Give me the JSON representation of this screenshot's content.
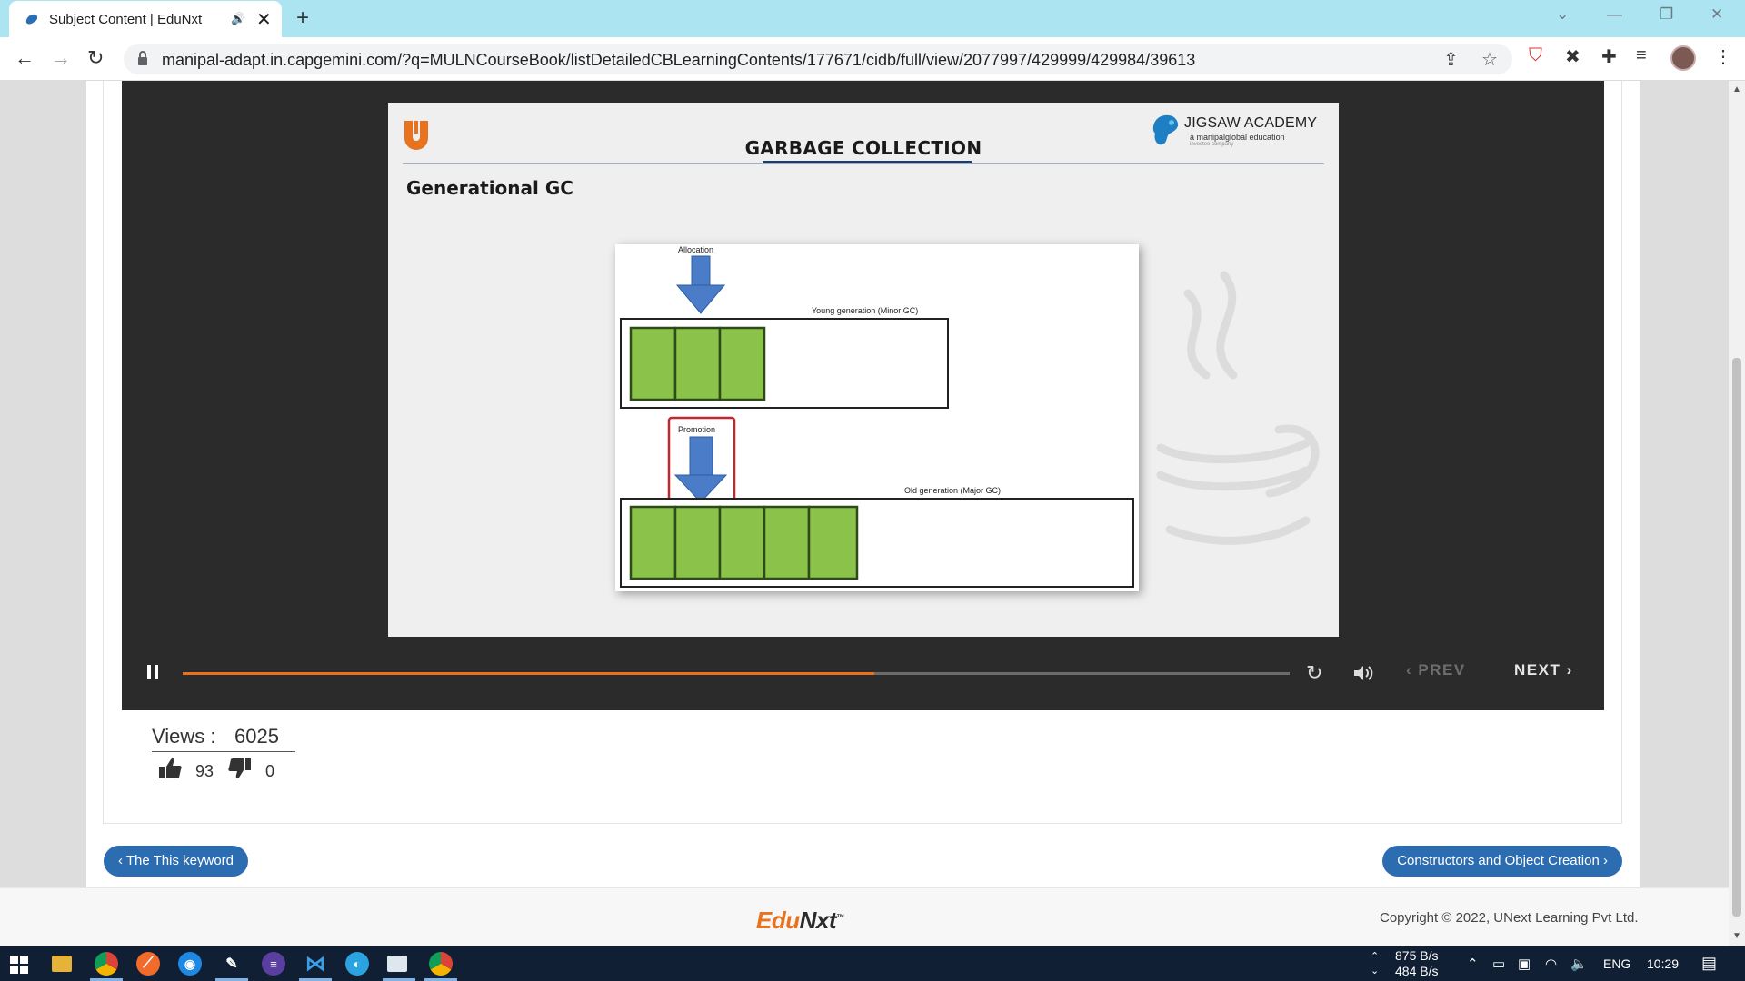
{
  "browser": {
    "tab_title": "Subject Content | EduNxt",
    "tab_audio_glyph": "🔊",
    "tab_close_glyph": "✕",
    "new_tab_glyph": "+",
    "url": "manipal-adapt.in.capgemini.com/?q=MULNCourseBook/listDetailedCBLearningContents/177671/cidb/full/view/2077997/429999/429984/39613"
  },
  "slide": {
    "title": "GARBAGE COLLECTION",
    "subtitle": "Generational GC",
    "brand_name": "JIGSAW ACADEMY",
    "brand_sub": "a manipalglobal education",
    "brand_tag": "investee company",
    "diagram": {
      "allocation_label": "Allocation",
      "young_label": "Young generation (Minor GC)",
      "promotion_label": "Promotion",
      "old_label": "Old generation (Major GC)"
    }
  },
  "player": {
    "progress_fraction": 0.625,
    "prev_label": "PREV",
    "next_label": "NEXT",
    "progress_color": "#e8721d"
  },
  "stats": {
    "views_label": "Views :",
    "views_value": "6025",
    "likes": "93",
    "dislikes": "0"
  },
  "navigation": {
    "prev_topic": "‹ The This keyword",
    "next_topic": "Constructors and Object Creation ›"
  },
  "footer": {
    "logo_part1": "Edu",
    "logo_part2": "Nxt",
    "logo_tm": "™",
    "copyright": "Copyright © 2022, UNext Learning Pvt Ltd."
  },
  "taskbar": {
    "upload_speed": "875 B/s",
    "download_speed": "484 B/s",
    "language": "ENG",
    "time": "10:29"
  },
  "colors": {
    "accent_blue": "#2c6cb0",
    "tab_strip": "#ade4f1",
    "player_bg": "#2b2b2b"
  }
}
